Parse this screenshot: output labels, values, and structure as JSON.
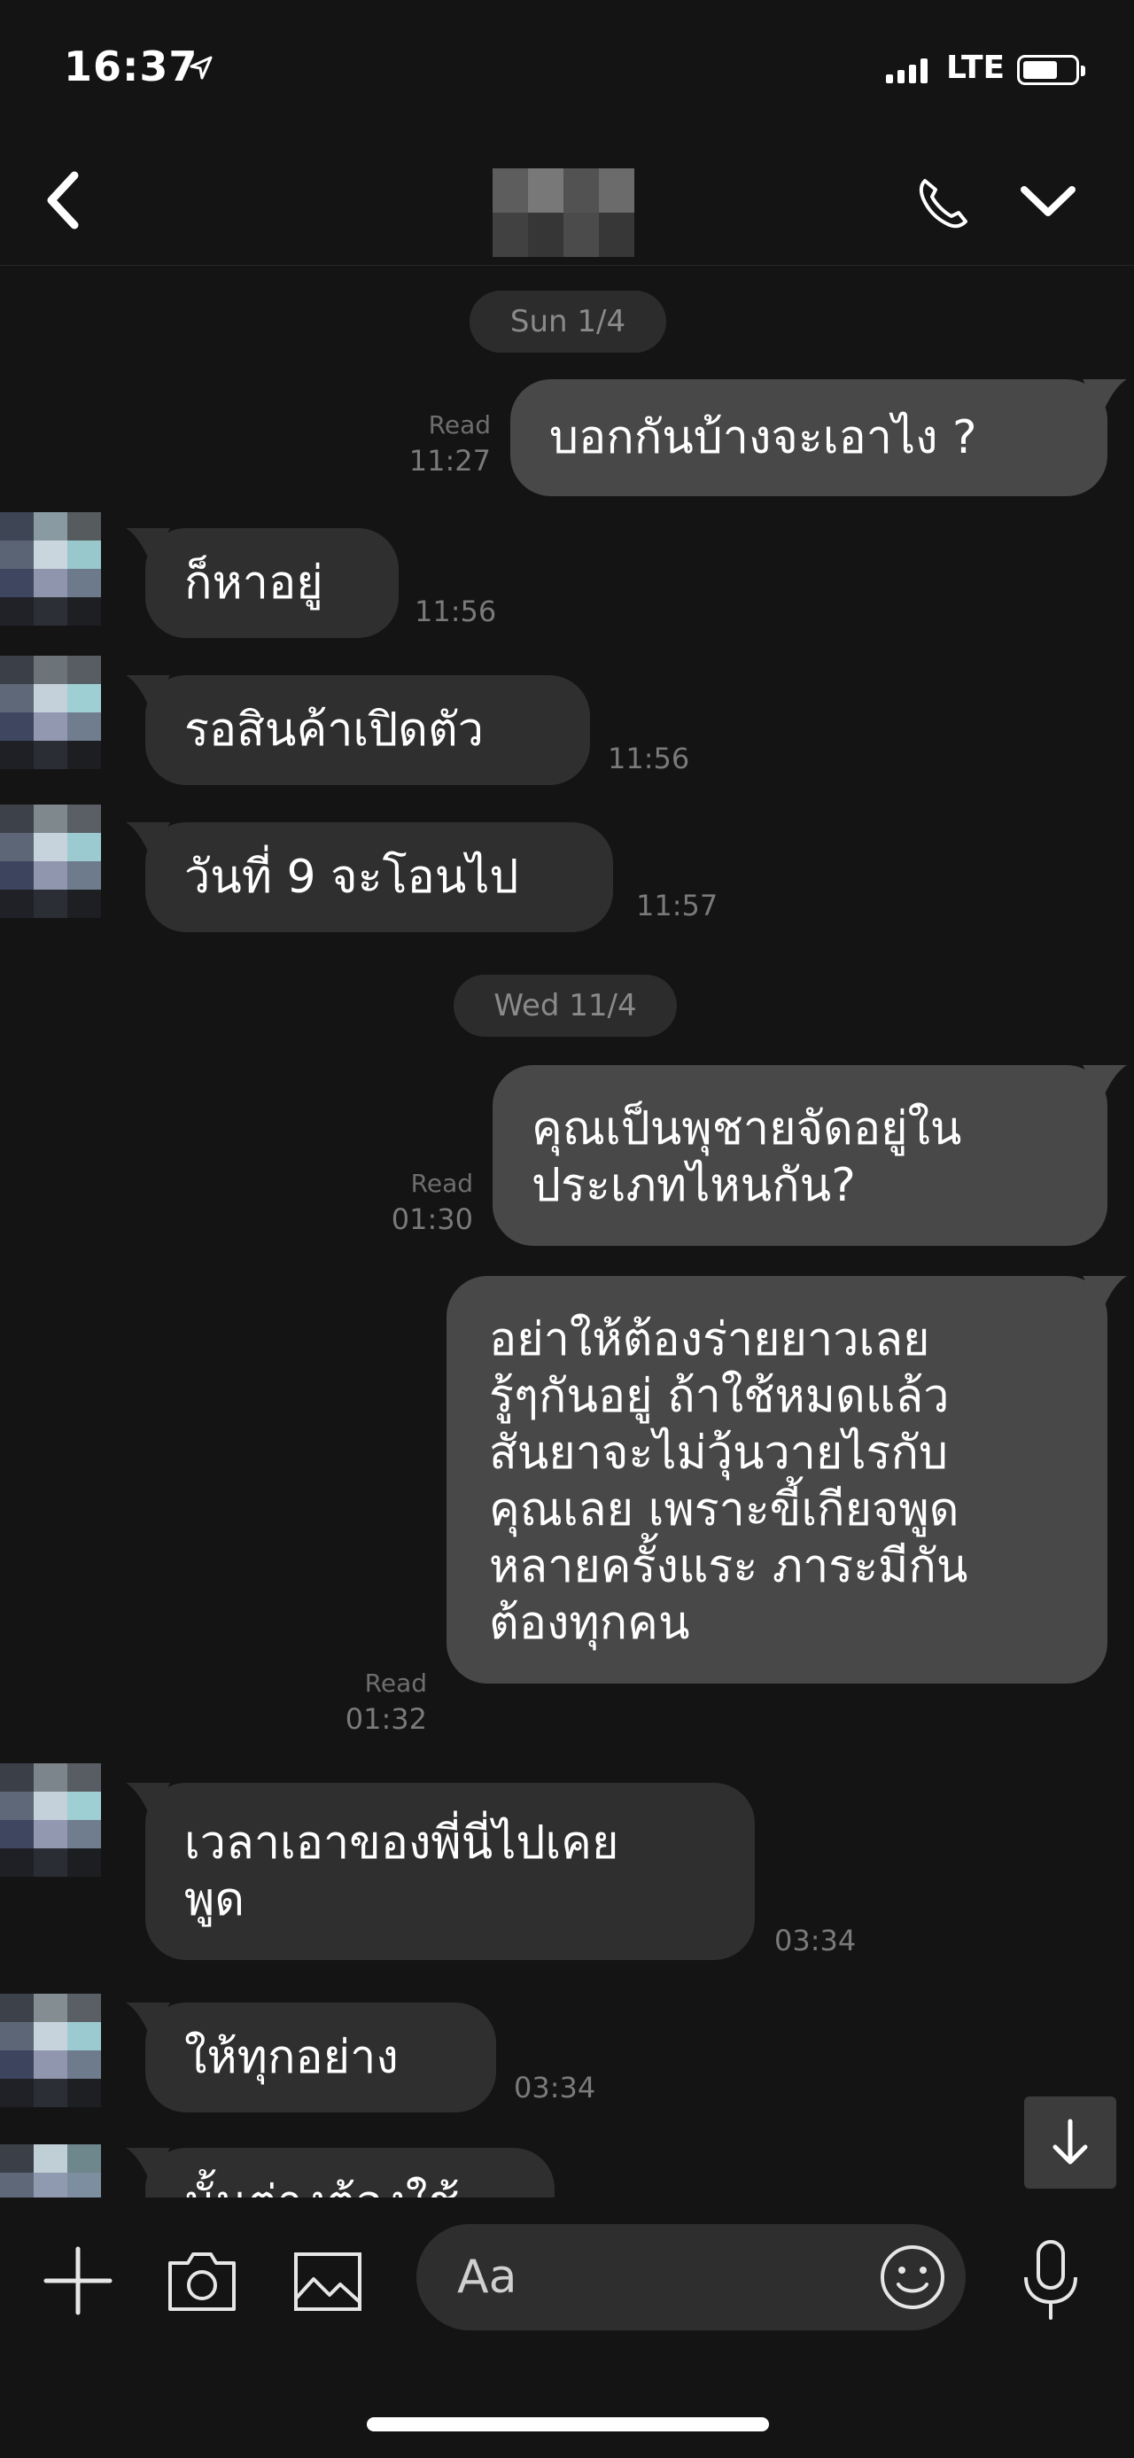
{
  "status_bar": {
    "time": "16:37",
    "network": "LTE"
  },
  "header": {
    "contact_name": "(blurred)"
  },
  "messages": [
    {
      "type": "date",
      "text": "Sun 1/4"
    },
    {
      "type": "outgoing",
      "lines": [
        "บอกกันบ้างจะเอาไง ?"
      ],
      "read": "Read",
      "time": "11:27"
    },
    {
      "type": "incoming",
      "lines": [
        "ก็หาอยู่"
      ],
      "time": "11:56"
    },
    {
      "type": "incoming",
      "lines": [
        "รอสินค้าเปิดตัว"
      ],
      "time": "11:56"
    },
    {
      "type": "incoming",
      "lines": [
        "วันที่ 9 จะโอนไป"
      ],
      "time": "11:57"
    },
    {
      "type": "date",
      "text": "Wed 11/4"
    },
    {
      "type": "outgoing",
      "lines": [
        "คุณเป็นพุชายจัดอยู่ใน",
        "ประเภทไหนกัน?"
      ],
      "read": "Read",
      "time": "01:30"
    },
    {
      "type": "outgoing",
      "lines": [
        "อย่าให้ต้องร่ายยาวเลย",
        "รู้ๆกันอยู่ ถ้าใช้หมดแล้ว",
        "สันยาจะไม่วุ้นวายไรกับ",
        "คุณเลย เพราะขี้เกียจพูด",
        "หลายครั้งแระ ภาระมีกัน",
        "ต้องทุกคน"
      ],
      "read": "Read",
      "time": "01:32"
    },
    {
      "type": "incoming",
      "lines": [
        "เวลาเอาของพี่นี่ไปเคย",
        "พูด"
      ],
      "time": "03:34"
    },
    {
      "type": "incoming",
      "lines": [
        "ให้ทุกอย่าง"
      ],
      "time": "03:34"
    },
    {
      "type": "incoming",
      "lines": [
        "นั้นต่างต้องใช้"
      ],
      "time": ""
    }
  ],
  "input_bar": {
    "placeholder": "Aa"
  },
  "icons": {
    "back": "chevron-left-icon",
    "call": "phone-icon",
    "menu": "chevron-down-icon",
    "add": "plus-icon",
    "camera": "camera-icon",
    "image": "image-icon",
    "emoji": "smiley-icon",
    "mic": "microphone-icon",
    "scroll": "arrow-down-icon"
  },
  "colors": {
    "background": "#141414",
    "incoming_bubble": "#2f2f2f",
    "outgoing_bubble": "#484848",
    "meta_text": "#7a7a7a"
  }
}
